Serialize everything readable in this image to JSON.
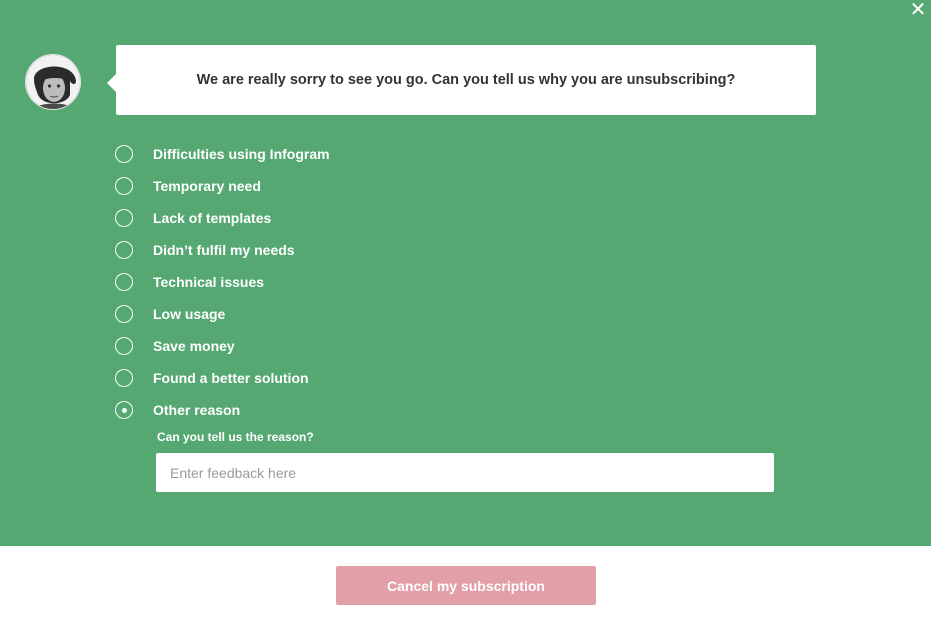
{
  "dialog": {
    "close_icon": "close-icon",
    "avatar_icon": "user-avatar",
    "question": "We are really sorry to see you go. Can you tell us why you are unsubscribing?"
  },
  "reasons": [
    {
      "label": "Difficulties using Infogram",
      "checked": false
    },
    {
      "label": "Temporary need",
      "checked": false
    },
    {
      "label": "Lack of templates",
      "checked": false
    },
    {
      "label": "Didn’t fulfil my needs",
      "checked": false
    },
    {
      "label": "Technical issues",
      "checked": false
    },
    {
      "label": "Low usage",
      "checked": false
    },
    {
      "label": "Save money",
      "checked": false
    },
    {
      "label": "Found a better solution",
      "checked": false
    },
    {
      "label": "Other reason",
      "checked": true
    }
  ],
  "feedback": {
    "label": "Can you tell us the reason?",
    "value": "",
    "placeholder": "Enter feedback here"
  },
  "footer": {
    "cancel_label": "Cancel my subscription"
  },
  "colors": {
    "background": "#55a872",
    "button": "#e29fa8",
    "text": "#ffffff"
  }
}
